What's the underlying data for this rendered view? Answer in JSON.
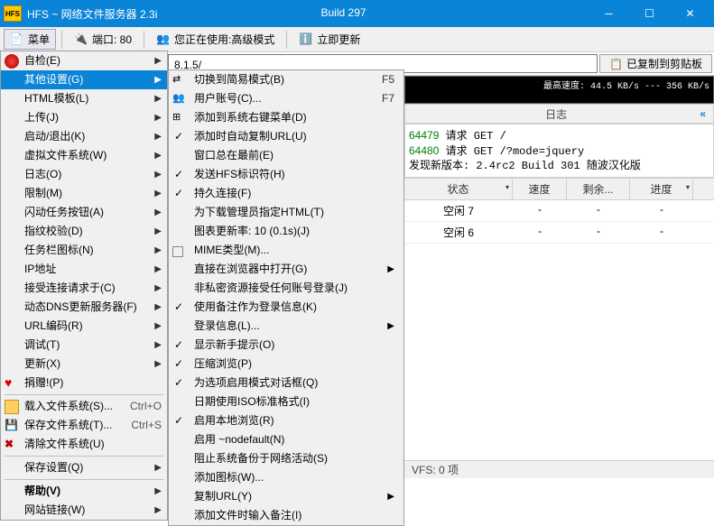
{
  "window": {
    "title": "HFS ~ 网络文件服务器 2.3i",
    "build": "Build 297"
  },
  "toolbar": {
    "menu": "菜单",
    "port_label": "端口: 80",
    "mode_label": "您正在使用:高级模式",
    "update_label": "立即更新"
  },
  "address": {
    "url_fragment": "8.1.5/",
    "copy_label": "已复制到剪贴板"
  },
  "graph": {
    "speed_text": "最高速度: 44.5 KB/s --- 356 KB/s"
  },
  "log": {
    "header": "日志",
    "lines": [
      {
        "id": "64479",
        "text": " 请求 GET /"
      },
      {
        "id": "64480",
        "text": " 请求 GET /?mode=jquery"
      }
    ],
    "extra": "发现新版本: 2.4rc2 Build 301 随波汉化版"
  },
  "connections": {
    "cols": [
      "状态",
      "速度",
      "剩余...",
      "进度"
    ],
    "rows": [
      [
        "空闲 7",
        "-",
        "-",
        "-"
      ],
      [
        "空闲 6",
        "-",
        "-",
        "-"
      ]
    ]
  },
  "status": {
    "vfs": "VFS: 0 项"
  },
  "context_menu": [
    {
      "label": "自检(E)",
      "arrow": true,
      "icon": "plus-red"
    },
    {
      "label": "其他设置(G)",
      "arrow": true,
      "hl": true
    },
    {
      "label": "HTML模板(L)",
      "arrow": true
    },
    {
      "label": "上传(J)",
      "arrow": true
    },
    {
      "label": "启动/退出(K)",
      "arrow": true
    },
    {
      "label": "虚拟文件系统(W)",
      "arrow": true
    },
    {
      "label": "日志(O)",
      "arrow": true
    },
    {
      "label": "限制(M)",
      "arrow": true
    },
    {
      "label": "闪动任务按钮(A)",
      "arrow": true
    },
    {
      "label": "指纹校验(D)",
      "arrow": true
    },
    {
      "label": "任务栏图标(N)",
      "arrow": true
    },
    {
      "label": "IP地址",
      "arrow": true
    },
    {
      "label": "接受连接请求于(C)",
      "arrow": true
    },
    {
      "label": "动态DNS更新服务器(F)",
      "arrow": true
    },
    {
      "label": "URL编码(R)",
      "arrow": true
    },
    {
      "label": "调试(T)",
      "arrow": true
    },
    {
      "label": "更新(X)",
      "arrow": true
    },
    {
      "label": "捐赠!(P)",
      "icon": "heart"
    },
    {
      "sep": true
    },
    {
      "label": "载入文件系统(S)...",
      "shortcut": "Ctrl+O",
      "icon": "folder"
    },
    {
      "label": "保存文件系统(T)...",
      "shortcut": "Ctrl+S",
      "icon": "disk"
    },
    {
      "label": "清除文件系统(U)",
      "icon": "x"
    },
    {
      "sep": true
    },
    {
      "label": "保存设置(Q)",
      "arrow": true
    },
    {
      "sep": true
    },
    {
      "label": "帮助(V)",
      "arrow": true,
      "bold": true
    },
    {
      "label": "网站链接(W)",
      "arrow": true
    }
  ],
  "submenu": [
    {
      "label": "切换到简易模式(B)",
      "sc": "F5",
      "icon": "swap"
    },
    {
      "label": "用户账号(C)...",
      "sc": "F7",
      "icon": "users"
    },
    {
      "label": "添加到系统右键菜单(D)",
      "icon": "win"
    },
    {
      "label": "添加时自动复制URL(U)",
      "chk": true
    },
    {
      "label": "窗口总在最前(E)"
    },
    {
      "label": "发送HFS标识符(H)",
      "chk": true
    },
    {
      "label": "持久连接(F)",
      "chk": true
    },
    {
      "label": "为下载管理员指定HTML(T)"
    },
    {
      "label": "图表更新率: 10 (0.1s)(J)"
    },
    {
      "label": "MIME类型(M)...",
      "icon": "box"
    },
    {
      "label": "直接在浏览器中打开(G)",
      "arrow": true
    },
    {
      "label": "非私密资源接受任何账号登录(J)"
    },
    {
      "label": "使用备注作为登录信息(K)",
      "chk": true
    },
    {
      "label": "登录信息(L)...",
      "arrow": true
    },
    {
      "label": "显示新手提示(O)",
      "chk": true
    },
    {
      "label": "压缩浏览(P)",
      "chk": true
    },
    {
      "label": "为选项启用模式对话框(Q)",
      "chk": true
    },
    {
      "label": "日期使用ISO标准格式(I)"
    },
    {
      "label": "启用本地浏览(R)",
      "chk": true
    },
    {
      "label": "启用 ~nodefault(N)"
    },
    {
      "label": "阻止系统备份于网络活动(S)"
    },
    {
      "label": "添加图标(W)..."
    },
    {
      "label": "复制URL(Y)",
      "arrow": true
    },
    {
      "label": "添加文件时输入备注(I)"
    }
  ]
}
